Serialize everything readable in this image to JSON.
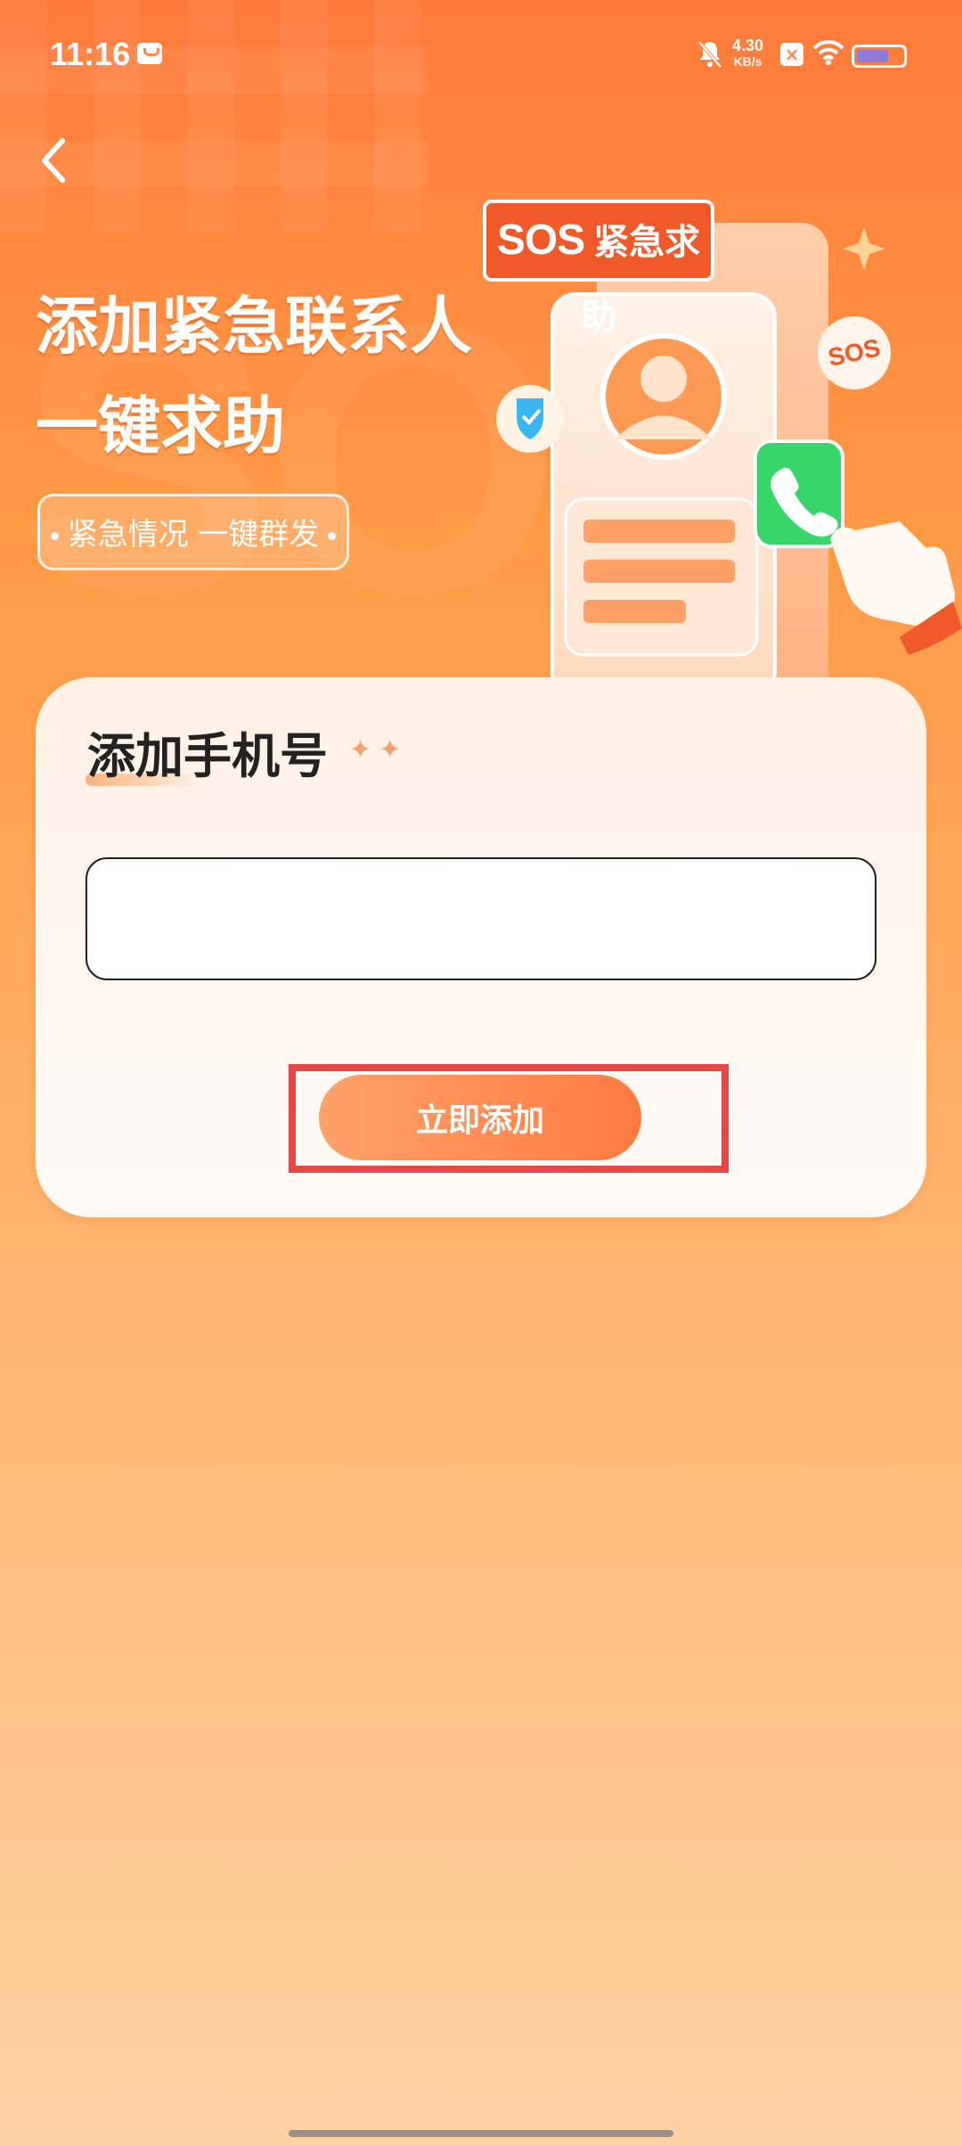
{
  "status_bar": {
    "time": "11:16",
    "speed_value": "4.30",
    "speed_unit": "KB/s",
    "battery_level": 0.7,
    "icons": [
      "message-icon",
      "bell-off-icon",
      "x-icon",
      "wifi-icon",
      "battery-icon"
    ]
  },
  "header": {
    "back_icon": "chevron-left-icon"
  },
  "hero": {
    "title_line1": "添加紧急联系人",
    "title_line2": "一键求助",
    "pill_text": "紧急情况 一键群发",
    "badge_sos": "SOS",
    "badge_text": "紧急求助",
    "circle_sos": "SOS"
  },
  "card": {
    "title": "添加手机号",
    "sparkles": "✦✦",
    "phone_input": {
      "value": "",
      "placeholder": ""
    },
    "add_button_label": "立即添加"
  },
  "colors": {
    "accent": "#ff7a40",
    "highlight": "#e64747",
    "background_top": "#ff7a3a",
    "background_bottom": "#ffd2a4"
  }
}
